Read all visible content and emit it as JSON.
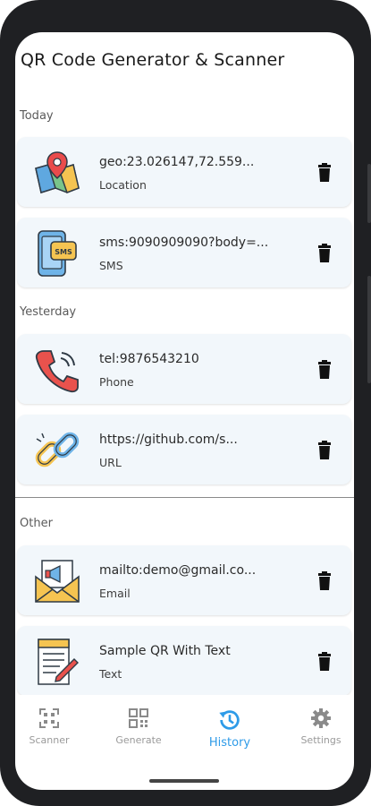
{
  "app": {
    "title": "QR Code Generator & Scanner"
  },
  "sections": {
    "today": "Today",
    "yesterday": "Yesterday",
    "other": "Other"
  },
  "items": [
    {
      "value": "geo:23.026147,72.559...",
      "type": "Location",
      "icon": "map-location-icon"
    },
    {
      "value": "sms:9090909090?body=...",
      "type": "SMS",
      "icon": "sms-phone-icon"
    },
    {
      "value": "tel:9876543210",
      "type": "Phone",
      "icon": "phone-call-icon"
    },
    {
      "value": "https://github.com/s...",
      "type": "URL",
      "icon": "link-chain-icon"
    },
    {
      "value": "mailto:demo@gmail.co...",
      "type": "Email",
      "icon": "email-envelope-icon"
    },
    {
      "value": "Sample QR With Text",
      "type": "Text",
      "icon": "text-note-icon"
    }
  ],
  "bottom_nav": {
    "items": [
      {
        "label": "Scanner",
        "icon": "qr-scan-icon",
        "active": false
      },
      {
        "label": "Generate",
        "icon": "qr-code-icon",
        "active": false
      },
      {
        "label": "History",
        "icon": "history-icon",
        "active": true
      },
      {
        "label": "Settings",
        "icon": "gear-icon",
        "active": false
      }
    ]
  },
  "colors": {
    "accent": "#2e9be8",
    "card": "#f2f7fb",
    "inactive": "#9a9a9a"
  }
}
